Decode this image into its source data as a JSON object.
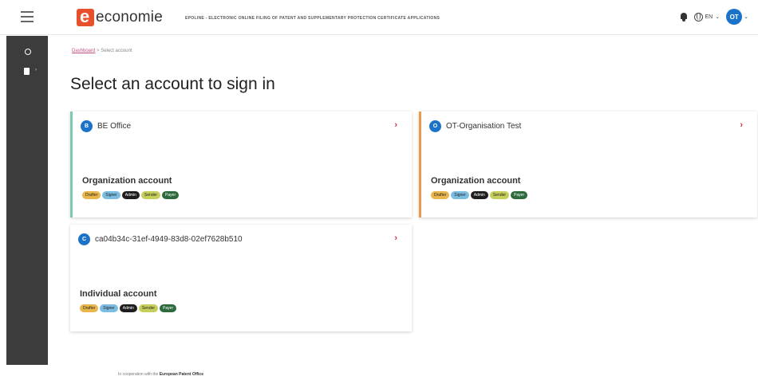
{
  "header": {
    "logo_text": "economie",
    "app_title": "EPOLINE - ELECTRONIC ONLINE FILING OF PATENT AND SUPPLEMENTARY PROTECTION CERTIFICATE APPLICATIONS",
    "language": "EN",
    "avatar_initials": "OT"
  },
  "breadcrumb": {
    "home": "Dashboard",
    "separator": ">",
    "current": "Select account"
  },
  "page_title": "Select an account to sign in",
  "roles": {
    "drafter": "Drafter",
    "signer": "Signer",
    "admin": "Admin",
    "sender": "Sender",
    "payer": "Payer"
  },
  "accounts": [
    {
      "initial": "B",
      "name": "BE Office",
      "type": "Organization account",
      "arrow": "›"
    },
    {
      "initial": "O",
      "name": "OT-Organisation Test",
      "type": "Organization account",
      "arrow": "›"
    },
    {
      "initial": "C",
      "name": "ca04b34c-31ef-4949-83d8-02ef7628b510",
      "type": "Individual account",
      "arrow": "›"
    }
  ],
  "footer": {
    "prefix": "In cooperation with the",
    "partner": "European Patent Office"
  },
  "colors": {
    "accent_blue": "#1a73c8",
    "arrow_red": "#d03040",
    "card1_border": "#7ec8b0",
    "card2_border": "#e89a4e",
    "sidebar_bg": "#3c3c3c"
  }
}
